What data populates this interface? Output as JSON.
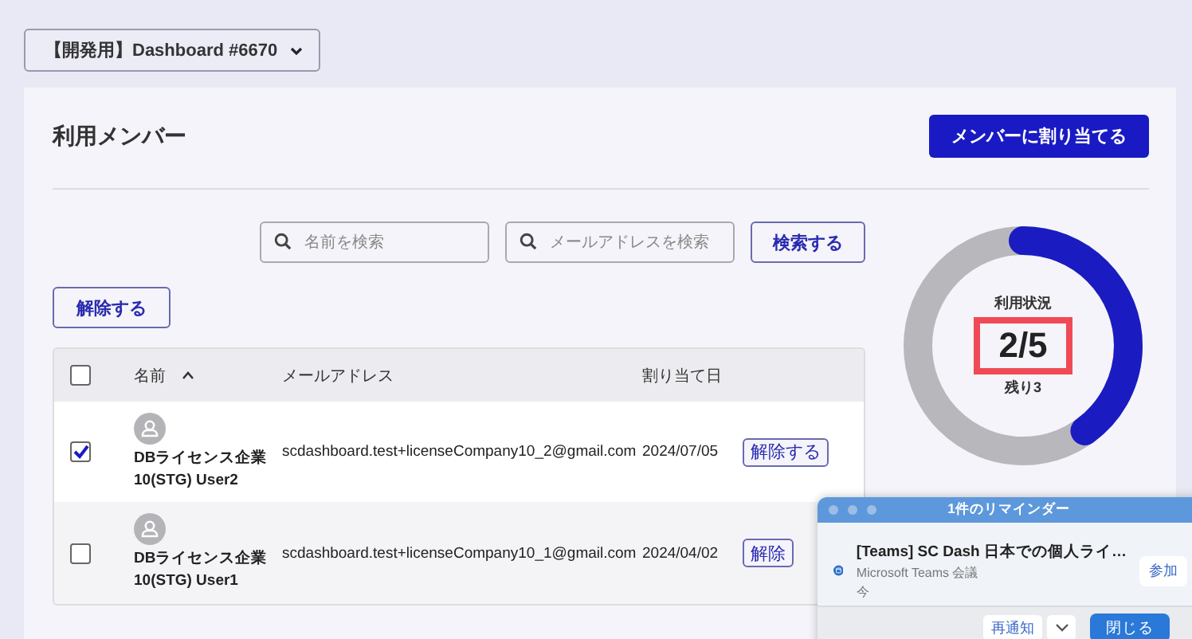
{
  "project_selector": {
    "label": "【開発用】Dashboard #6670"
  },
  "section": {
    "title": "利用メンバー",
    "assign_button": "メンバーに割り当てる"
  },
  "search": {
    "name_placeholder": "名前を検索",
    "email_placeholder": "メールアドレスを検索",
    "button": "検索する"
  },
  "release_button": "解除する",
  "table": {
    "header_checked": false,
    "columns": [
      "名前",
      "メールアドレス",
      "割り当て日"
    ],
    "sort_ascending": true,
    "rows": [
      {
        "checked": true,
        "name": "DBライセンス企業 10(STG) User2",
        "email": "scdashboard.test+licenseCompany10_2@gmail.com",
        "date": "2024/07/05",
        "action": "解除する"
      },
      {
        "checked": false,
        "name": "DBライセンス企業 10(STG) User1",
        "email": "scdashboard.test+licenseCompany10_1@gmail.com",
        "date": "2024/04/02",
        "action": "解除"
      }
    ]
  },
  "usage": {
    "label": "利用状況",
    "value": "2/5",
    "remaining": "残り3",
    "level": 0.4
  },
  "notification": {
    "title": "1件のリマインダー",
    "event": "[Teams] SC Dash 日本での個人ライ…",
    "subtitle": "Microsoft Teams 会議",
    "time": "今",
    "join": "参加",
    "snooze": "再通知",
    "close": "閉じる"
  }
}
